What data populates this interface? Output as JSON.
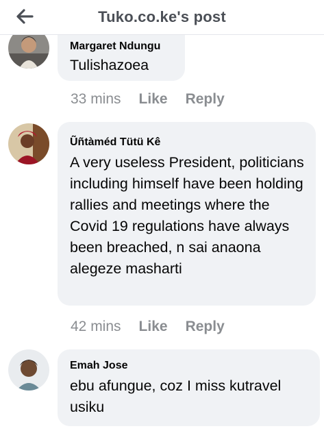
{
  "header": {
    "title": "Tuko.co.ke's post",
    "back_icon": "arrow-left-icon"
  },
  "comments": [
    {
      "author": "Margaret Ndungu",
      "text": "Tulishazoea",
      "time": "33 mins",
      "like_label": "Like",
      "reply_label": "Reply"
    },
    {
      "author": "Ũñtàméd Tütü Kê",
      "text": "A very useless President, politicians including himself have been holding rallies and meetings where the Covid 19 regulations have always been breached, n sai anaona alegeze masharti",
      "time": "42 mins",
      "like_label": "Like",
      "reply_label": "Reply"
    },
    {
      "author": "Emah Jose",
      "text": "ebu afungue, coz I miss kutravel usiku"
    }
  ]
}
